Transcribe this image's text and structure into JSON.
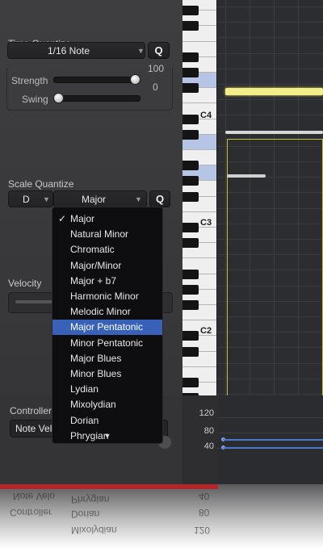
{
  "time_quantize": {
    "title": "Time Quantize",
    "value": "1/16 Note",
    "q_label": "Q",
    "strength_label": "Strength",
    "strength_value": "100",
    "strength_level": 1.0,
    "swing_label": "Swing",
    "swing_value": "0",
    "swing_level": 0.0
  },
  "scale_quantize": {
    "title": "Scale Quantize",
    "root": "D",
    "scale": "Major",
    "q_label": "Q"
  },
  "velocity": {
    "label": "Velocity"
  },
  "scale_menu": {
    "items": [
      "Major",
      "Natural Minor",
      "Chromatic",
      "Major/Minor",
      "Major + b7",
      "Harmonic Minor",
      "Melodic Minor",
      "Major Pentatonic",
      "Minor Pentatonic",
      "Major Blues",
      "Minor Blues",
      "Lydian",
      "Mixolydian",
      "Dorian",
      "Phrygian"
    ],
    "checked": "Major",
    "highlighted": "Major Pentatonic",
    "more_indicator": "▼"
  },
  "piano": {
    "labels": [
      "C4",
      "C3",
      "C2"
    ]
  },
  "controller": {
    "title": "Controller",
    "value": "Note Velocity",
    "ruler_ticks": [
      "120",
      "80",
      "40"
    ]
  },
  "reflection": {
    "texts": [
      "Note Velo",
      "Controller",
      "Phrygian",
      "Dorian",
      "Mixolydian",
      "40",
      "80",
      "120"
    ]
  },
  "colors": {
    "accent": "#3762b8",
    "region_border": "#c9c236",
    "note_yellow": "#f2ee8c",
    "piano_highlight": "#b6c5e6"
  }
}
